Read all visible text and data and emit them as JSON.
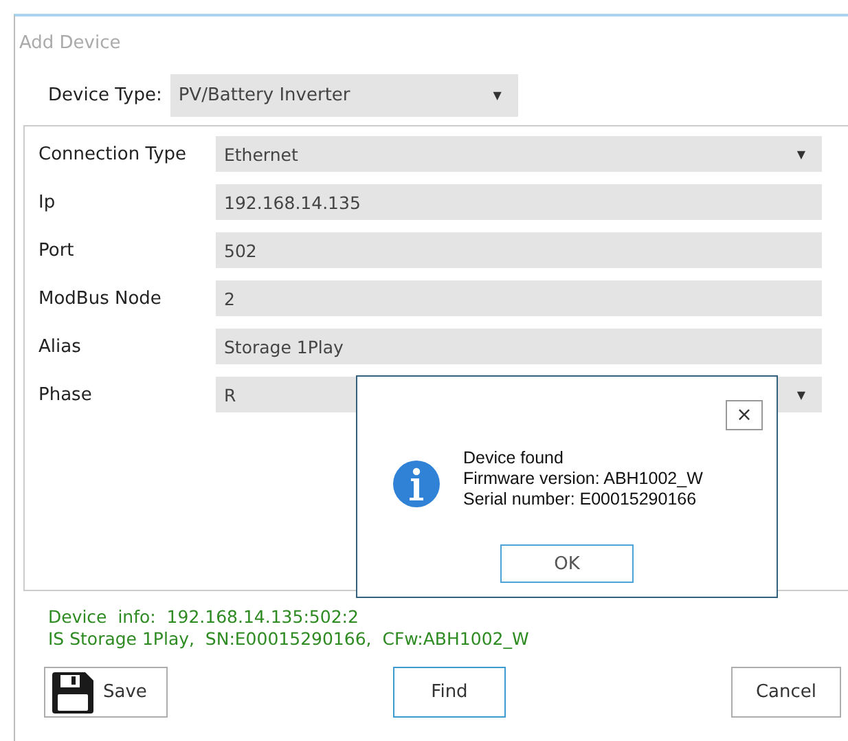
{
  "window": {
    "title": "Add Device"
  },
  "device_type": {
    "label": "Device Type:",
    "value": "PV/Battery Inverter",
    "arrow": "▼"
  },
  "fields": [
    {
      "label": "Connection Type",
      "value": "Ethernet",
      "kind": "dropdown",
      "arrow": "▼"
    },
    {
      "label": "Ip",
      "value": "192.168.14.135",
      "kind": "text"
    },
    {
      "label": "Port",
      "value": "502",
      "kind": "text"
    },
    {
      "label": "ModBus Node",
      "value": "2",
      "kind": "text"
    },
    {
      "label": "Alias",
      "value": "Storage 1Play",
      "kind": "text"
    },
    {
      "label": "Phase",
      "value": "R",
      "kind": "dropdown",
      "arrow": "▼"
    }
  ],
  "dialog": {
    "close": "×",
    "lines": [
      "Device found",
      "Firmware version: ABH1002_W",
      "Serial number: E00015290166"
    ],
    "button": "OK"
  },
  "device_info": [
    "Device  info:  192.168.14.135:502:2",
    "IS Storage 1Play,  SN:E00015290166,  CFw:ABH1002_W"
  ],
  "buttons": [
    {
      "label": "Save",
      "kind": "save"
    },
    {
      "label": "Find",
      "kind": "find"
    },
    {
      "label": "Cancel",
      "kind": "cancel"
    }
  ]
}
